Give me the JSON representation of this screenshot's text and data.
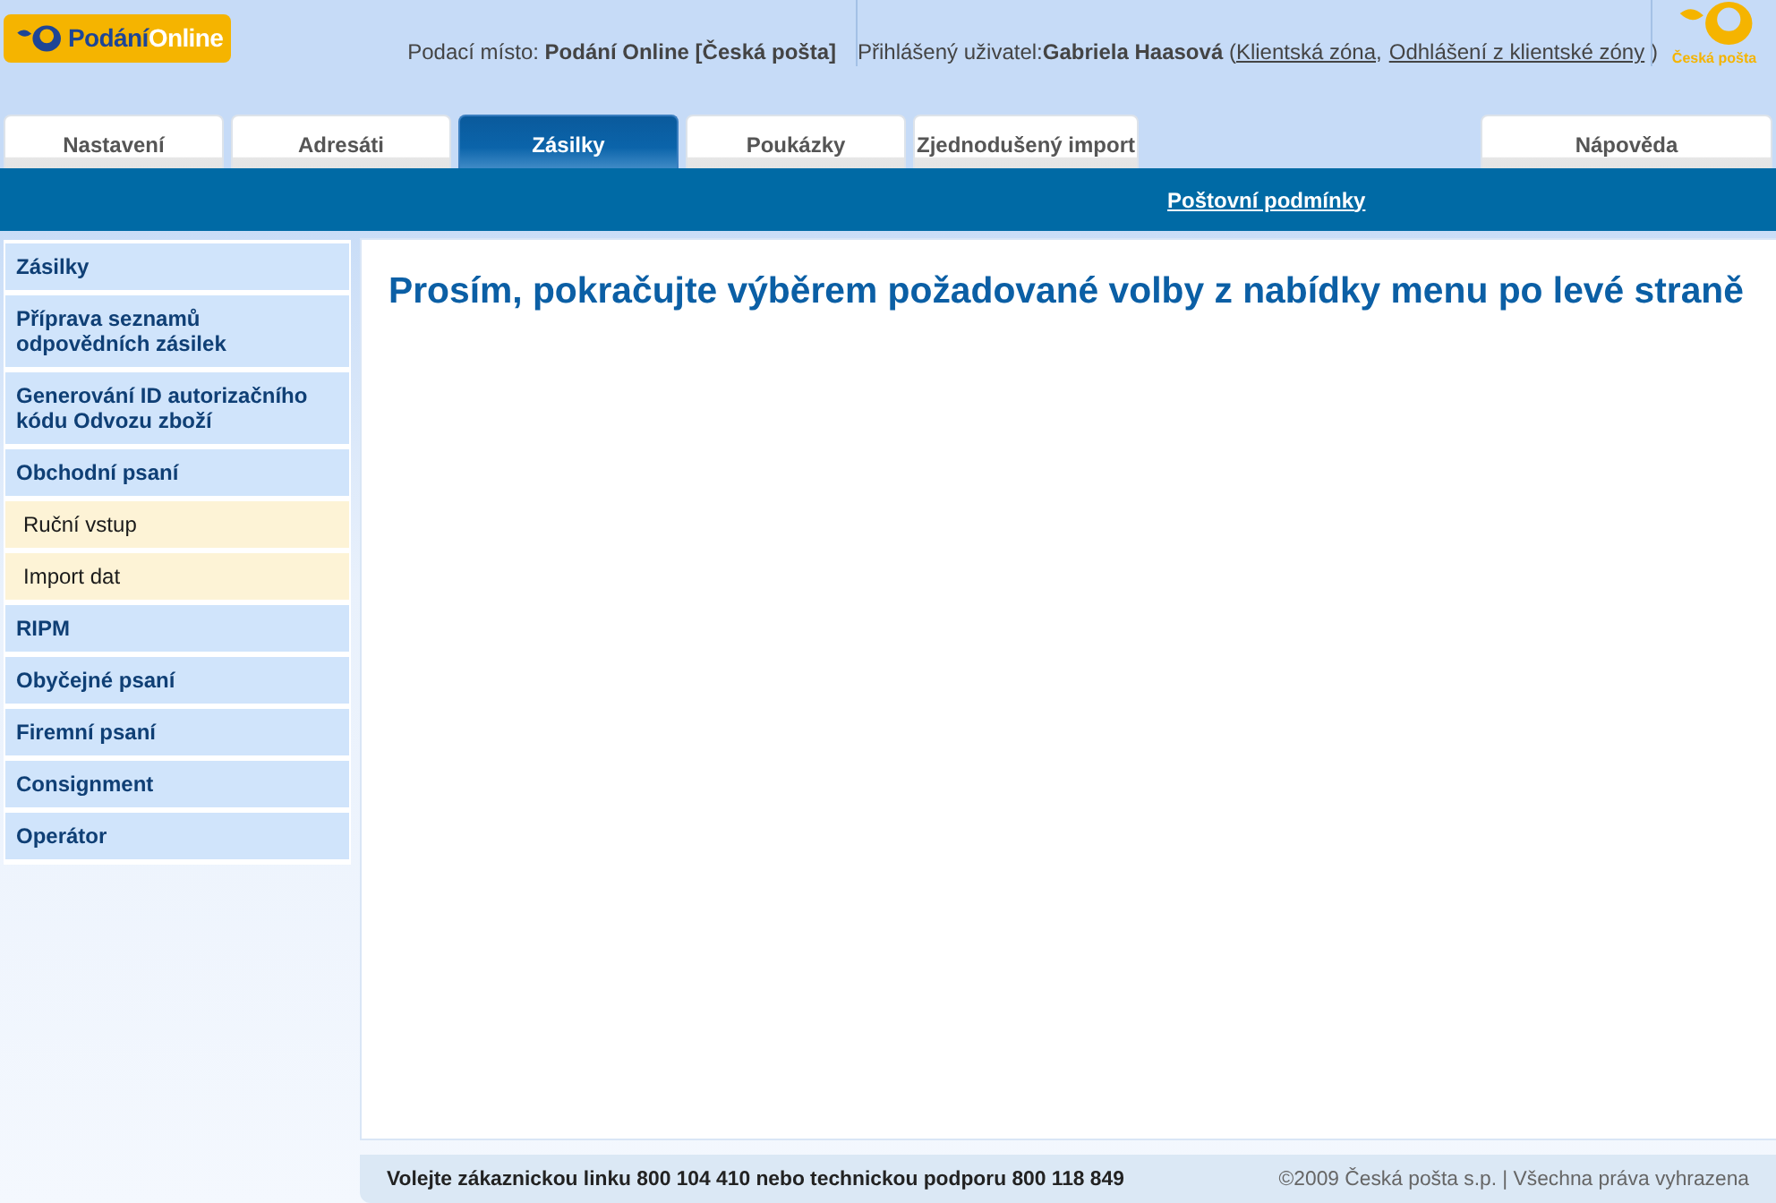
{
  "header": {
    "logo": {
      "text_1": "Podání",
      "text_2": "Online"
    },
    "post_office": "Podací místo: **Podání Online [Česká pošta]**",
    "user": {
      "text": "Přihlášený uživatel:**Gabriela Haasová**",
      "open": "(",
      "links": [
        "Klientská zóna",
        "Odhlášení z klientské zóny"
      ],
      "separator": ",",
      "close": ")"
    },
    "brand": "Česká pošta"
  },
  "tabs": [
    {
      "label": "Nastavení",
      "selected": false
    },
    {
      "label": "Adresáti",
      "selected": false
    },
    {
      "label": "Zásilky",
      "selected": true
    },
    {
      "label": "Poukázky",
      "selected": false
    },
    {
      "label": "Zjednodušený import",
      "selected": false
    }
  ],
  "help_tab": {
    "label": "Nápověda",
    "selected": false
  },
  "nav_bar": {
    "link": "Poštovní podmínky"
  },
  "sidebar": {
    "items": [
      {
        "label": "Zásilky"
      },
      {
        "label": "Příprava seznamů odpovědních zásilek"
      },
      {
        "label": "Generování ID autorizačního kódu Odvozu zboží"
      },
      {
        "label": "Obchodní psaní",
        "children": [
          {
            "label": "Ruční vstup"
          },
          {
            "label": "Import dat"
          }
        ]
      },
      {
        "label": "RIPM"
      },
      {
        "label": "Obyčejné psaní"
      },
      {
        "label": "Firemní psaní"
      },
      {
        "label": "Consignment"
      },
      {
        "label": "Operátor"
      }
    ]
  },
  "content": {
    "heading": "Prosím, pokračujte výběrem požadované volby z nabídky menu po levé straně"
  },
  "footer": {
    "hotline": "Volejte zákaznickou linku 800 104 410 nebo technickou podporu 800 118 849",
    "copyright": "©2009 Česká pošta s.p. | Všechna práva vyhrazena"
  }
}
